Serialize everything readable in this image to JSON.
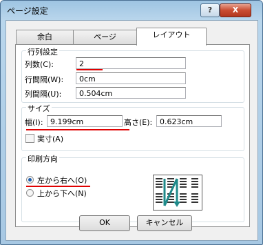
{
  "window": {
    "title": "ページ設定"
  },
  "titlebar": {
    "help_label": "?",
    "close_label": "X"
  },
  "tabs": [
    {
      "label": "余白"
    },
    {
      "label": "ページ"
    },
    {
      "label": "レイアウト"
    }
  ],
  "row_col": {
    "title": "行列設定",
    "columns_label": "列数(C):",
    "columns_value": "2",
    "line_spacing_label": "行間隔(W):",
    "line_spacing_value": "0cm",
    "col_spacing_label": "列間隔(U):",
    "col_spacing_value": "0.504cm"
  },
  "size": {
    "title": "サイズ",
    "width_label": "幅(I):",
    "width_value": "9.199cm",
    "height_label": "高さ(E):",
    "height_value": "0.623cm",
    "actual_label": "実寸(A)"
  },
  "print_direction": {
    "title": "印刷方向",
    "left_to_right_label": "左から右へ(O)",
    "top_to_bottom_label": "上から下へ(N)",
    "selected": "left_to_right"
  },
  "buttons": {
    "ok": "OK",
    "cancel": "キャンセル"
  },
  "colors": {
    "annotation_red": "#e00000",
    "arrow_teal": "#1e8a8a"
  }
}
